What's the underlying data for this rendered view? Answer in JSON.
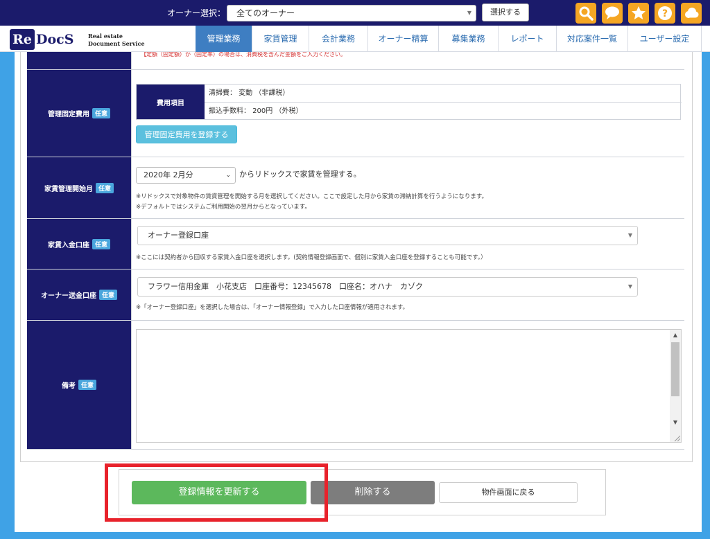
{
  "topbar": {
    "owner_label": "オーナー選択：",
    "owner_select_value": "全てのオーナー",
    "select_button": "選択する",
    "icons": [
      "search-icon",
      "chat-icon",
      "star-icon",
      "help-icon",
      "cloud-icon"
    ],
    "icon_color": "#f5a623",
    "bar_color": "#1b1b6b"
  },
  "logo": {
    "mark": "Re",
    "name": "DocS",
    "sub1": "Real estate",
    "sub2": "Document Service"
  },
  "nav": {
    "items": [
      "管理業務",
      "家賃管理",
      "会計業務",
      "オーナー精算",
      "募集業務",
      "レポート",
      "対応案件一覧",
      "ユーザー設定"
    ],
    "active": "管理業務"
  },
  "form": {
    "top_note": "【定額（固定額）か（固定率）の場合は、消費税を含んだ金額をご入力ください。",
    "optional_badge": "任意",
    "fixed_fee": {
      "label": "管理固定費用",
      "table_header": "費用項目",
      "lines": [
        "清掃費： 変動 （非課税）",
        "振込手数料： 200円 （外税）"
      ],
      "register_button": "管理固定費用を登録する"
    },
    "rent_start": {
      "label": "家賃管理開始月",
      "select_value": "2020年 2月分",
      "after_text": "からリドックスで家賃を管理する。",
      "note1": "※リドックスで対象物件の賃貸管理を開始する月を選択してください。ここで設定した月から家賃の滞納計算を行うようになります。",
      "note2": "※デフォルトではシステムご利用開始の翌月からとなっています。"
    },
    "deposit_account": {
      "label": "家賃入金口座",
      "select_value": "オーナー登録口座",
      "note": "※ここには契約者から回収する家賃入金口座を選択します。(契約情報登録画面で、個別に家賃入金口座を登録することも可能です。）"
    },
    "owner_account": {
      "label": "オーナー送金口座",
      "select_value": "フラワー信用金庫　小花支店　口座番号：12345678　口座名：オハナ　カゾク",
      "note": "※「オーナー登録口座」を選択した場合は、「オーナー情報登録」で入力した口座情報が適用されます。"
    },
    "remarks": {
      "label": "備考",
      "value": ""
    }
  },
  "buttons": {
    "update": "登録情報を更新する",
    "delete": "削除する",
    "back": "物件画面に戻る"
  },
  "colors": {
    "update": "#5cb85c",
    "delete": "#7d7d7d",
    "highlight": "#e8222b",
    "label_bg": "#1b1b6b",
    "badge": "#4aa6dd",
    "background": "#3fa2e6"
  }
}
